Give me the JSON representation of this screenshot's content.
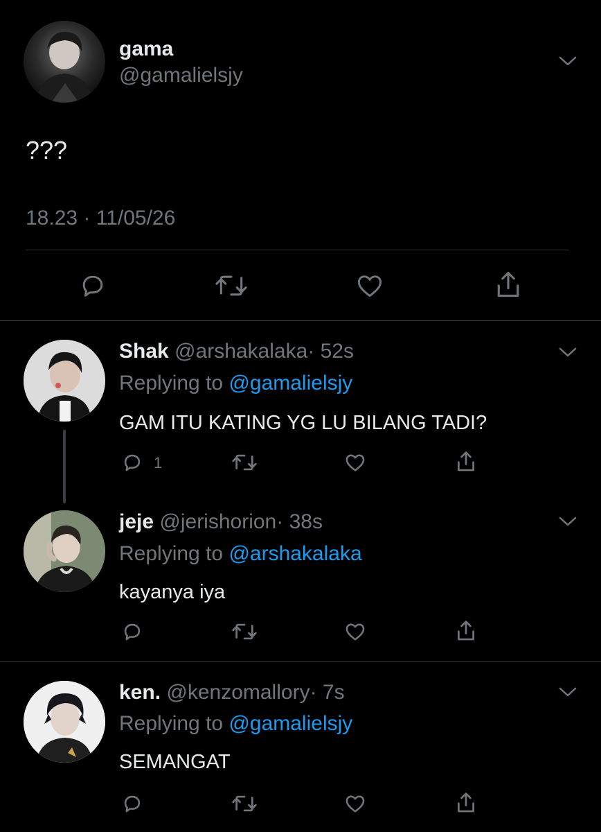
{
  "main_tweet": {
    "display_name": "gama",
    "handle": "@gamalielsjy",
    "text": "???",
    "timestamp": "18.23 · 11/05/26"
  },
  "replies": [
    {
      "display_name": "Shak",
      "handle": "@arshakalaka",
      "age": "· 52s",
      "replying_label": "Replying to",
      "replying_to": "@gamalielsjy",
      "text": "GAM ITU KATING YG LU BILANG TADI?",
      "reply_count": "1"
    },
    {
      "display_name": "jeje",
      "handle": "@jerishorion",
      "age": "· 38s",
      "replying_label": "Replying to",
      "replying_to": "@arshakalaka",
      "text": "kayanya iya",
      "reply_count": ""
    },
    {
      "display_name": "ken.",
      "handle": "@kenzomallory",
      "age": "· 7s",
      "replying_label": "Replying to",
      "replying_to": "@gamalielsjy",
      "text": "SEMANGAT",
      "reply_count": ""
    }
  ],
  "icons": {
    "reply": "reply-icon",
    "retweet": "retweet-icon",
    "like": "heart-icon",
    "share": "share-icon",
    "more": "chevron-down-icon"
  },
  "colors": {
    "background": "#000000",
    "text": "#e7e9ea",
    "muted": "#71767b",
    "link": "#1d9bf0",
    "divider": "#2f3336"
  }
}
